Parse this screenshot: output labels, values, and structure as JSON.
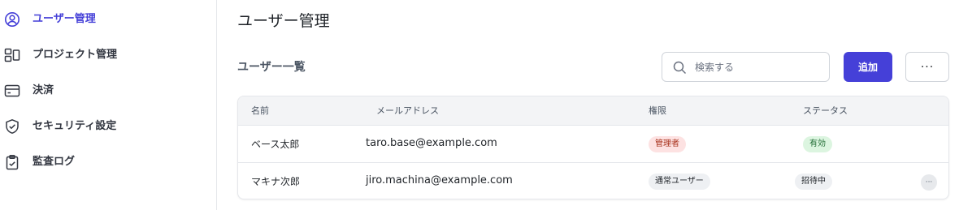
{
  "sidebar": {
    "items": [
      {
        "label": "ユーザー管理",
        "icon": "user-circle-icon",
        "active": true
      },
      {
        "label": "プロジェクト管理",
        "icon": "layout-icon",
        "active": false
      },
      {
        "label": "決済",
        "icon": "credit-card-icon",
        "active": false
      },
      {
        "label": "セキュリティ設定",
        "icon": "shield-check-icon",
        "active": false
      },
      {
        "label": "監査ログ",
        "icon": "clipboard-check-icon",
        "active": false
      }
    ]
  },
  "main": {
    "title": "ユーザー管理",
    "section_title": "ユーザー一覧",
    "search": {
      "placeholder": "検索する",
      "value": ""
    },
    "add_button": "追加",
    "more_button": "···"
  },
  "table": {
    "columns": [
      "名前",
      "メールアドレス",
      "権限",
      "ステータス"
    ],
    "rows": [
      {
        "name": "ベース太郎",
        "email": "taro.base@example.com",
        "role": "管理者",
        "status": "有効"
      },
      {
        "name": "マキナ次郎",
        "email": "jiro.machina@example.com",
        "role": "通常ユーザー",
        "status": "招待中",
        "more": "···"
      }
    ]
  },
  "colors": {
    "accent": "#4540d8",
    "admin_badge_bg": "#fde2e2",
    "admin_badge_text": "#a8321c",
    "active_badge_bg": "#dcf5e0",
    "active_badge_text": "#1f6b33",
    "neutral_badge_bg": "#eef0f3"
  }
}
